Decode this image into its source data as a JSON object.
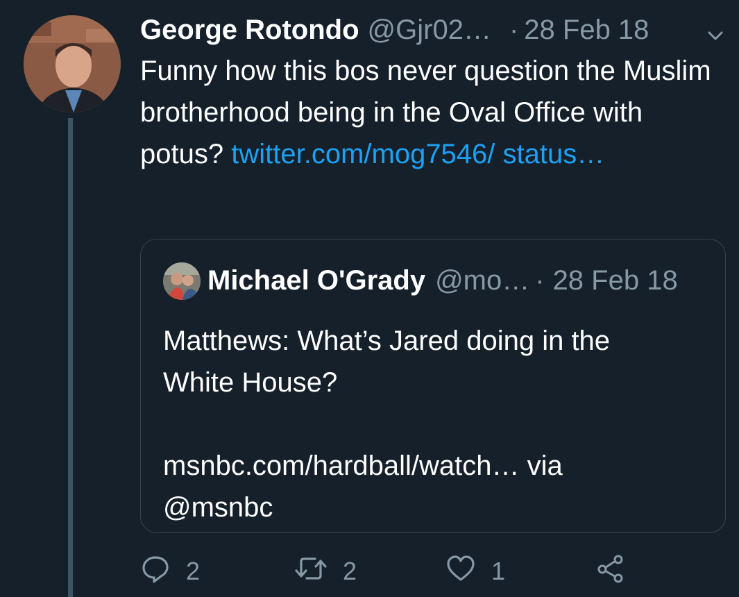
{
  "tweet": {
    "author_name": "George Rotondo",
    "author_handle": "@Gjr02…",
    "separator": "·",
    "date": "28 Feb 18",
    "text": "Funny how this bos never question the Muslim brotherhood being in the Oval Office with potus?",
    "link_line1": "twitter.com/mog7546/",
    "link_line2": "status…"
  },
  "quoted_tweet": {
    "author_name": "Michael O'Grady",
    "author_handle": "@mo…",
    "separator": "·",
    "date": "28 Feb 18",
    "text_line1": "Matthews: What’s Jared doing in the",
    "text_line2": "White House?",
    "text_line3": "msnbc.com/hardball/watch… via",
    "text_line4": "@msnbc"
  },
  "actions": {
    "reply_count": "2",
    "retweet_count": "2",
    "like_count": "1"
  },
  "icons": {
    "chevron": "chevron-down-icon",
    "reply": "reply-icon",
    "retweet": "retweet-icon",
    "like": "heart-icon",
    "share": "share-icon"
  },
  "colors": {
    "background": "#15202b",
    "text": "#ffffff",
    "secondary": "#8899a6",
    "link": "#1da1f2",
    "border": "#38444d"
  }
}
